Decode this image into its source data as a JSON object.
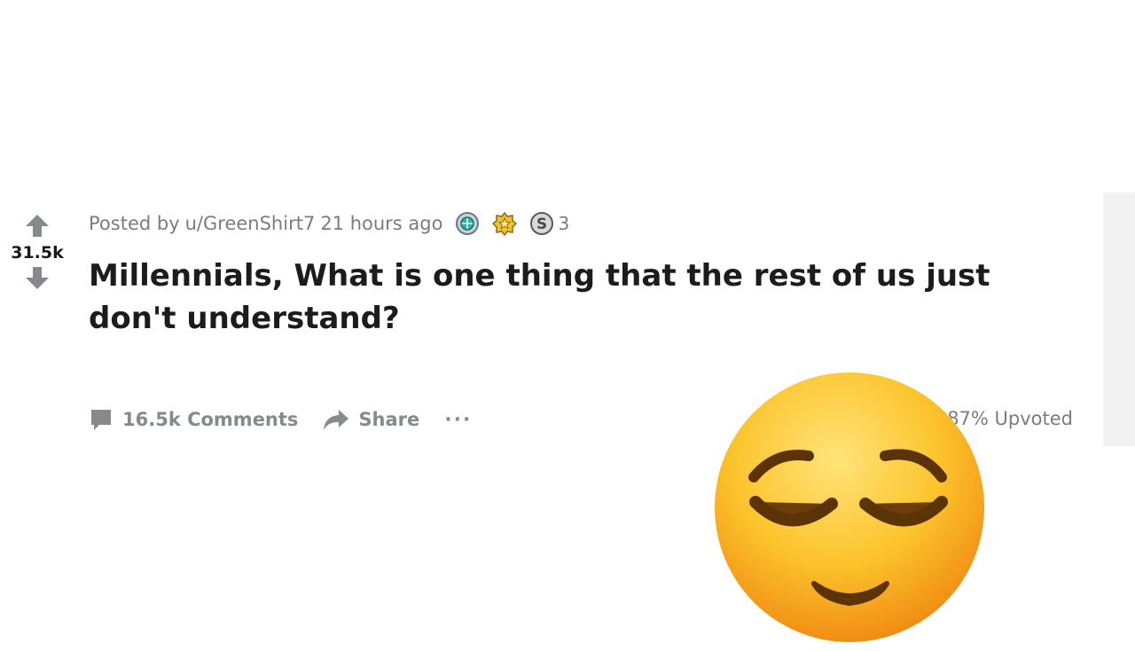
{
  "post": {
    "score": "31.5k",
    "meta": {
      "prefix": "Posted by",
      "author": "u/GreenShirt7",
      "time": "21 hours ago",
      "award_count": "3"
    },
    "title": "Millennials, What is one thing that the rest of us just don't understand?",
    "actions": {
      "comments": "16.5k Comments",
      "share": "Share",
      "more": "···"
    },
    "upvoted": "87% Upvoted"
  },
  "icons": {
    "upvote": "upvote-arrow-icon",
    "downvote": "downvote-arrow-icon",
    "comment": "comment-bubble-icon",
    "share": "share-arrow-icon",
    "awards": [
      "platinum-award-icon",
      "gold-award-icon",
      "silver-award-icon"
    ],
    "overlay": "relieved-face-emoji"
  },
  "colors": {
    "text_primary": "#1c1c1c",
    "text_meta": "#7c7c7c",
    "action_gray": "#878a8c",
    "arrow_gray": "#878a8c",
    "gutter": "#f2f2f2"
  }
}
